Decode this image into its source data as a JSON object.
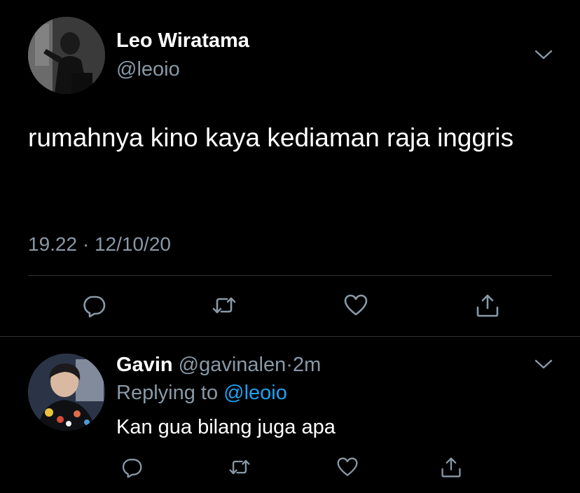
{
  "main_tweet": {
    "author_name": "Leo Wiratama",
    "author_handle": "@leoio",
    "text": "rumahnya kino kaya kediaman raja inggris",
    "time": "19.22",
    "separator": "·",
    "date": "12/10/20"
  },
  "reply": {
    "author_name": "Gavin",
    "author_handle": "@gavinalen",
    "separator": "·",
    "age": "2m",
    "replying_prefix": "Replying to",
    "replying_handle": "@leoio",
    "text": "Kan gua bilang juga apa"
  },
  "icons": {
    "reply": "reply-bubble-icon",
    "retweet": "retweet-icon",
    "like": "heart-icon",
    "share": "share-icon",
    "menu": "chevron-down-icon"
  },
  "colors": {
    "background": "#000000",
    "text": "#ffffff",
    "secondary": "#8899a6",
    "link": "#1da1f2",
    "divider": "#2f3336"
  }
}
